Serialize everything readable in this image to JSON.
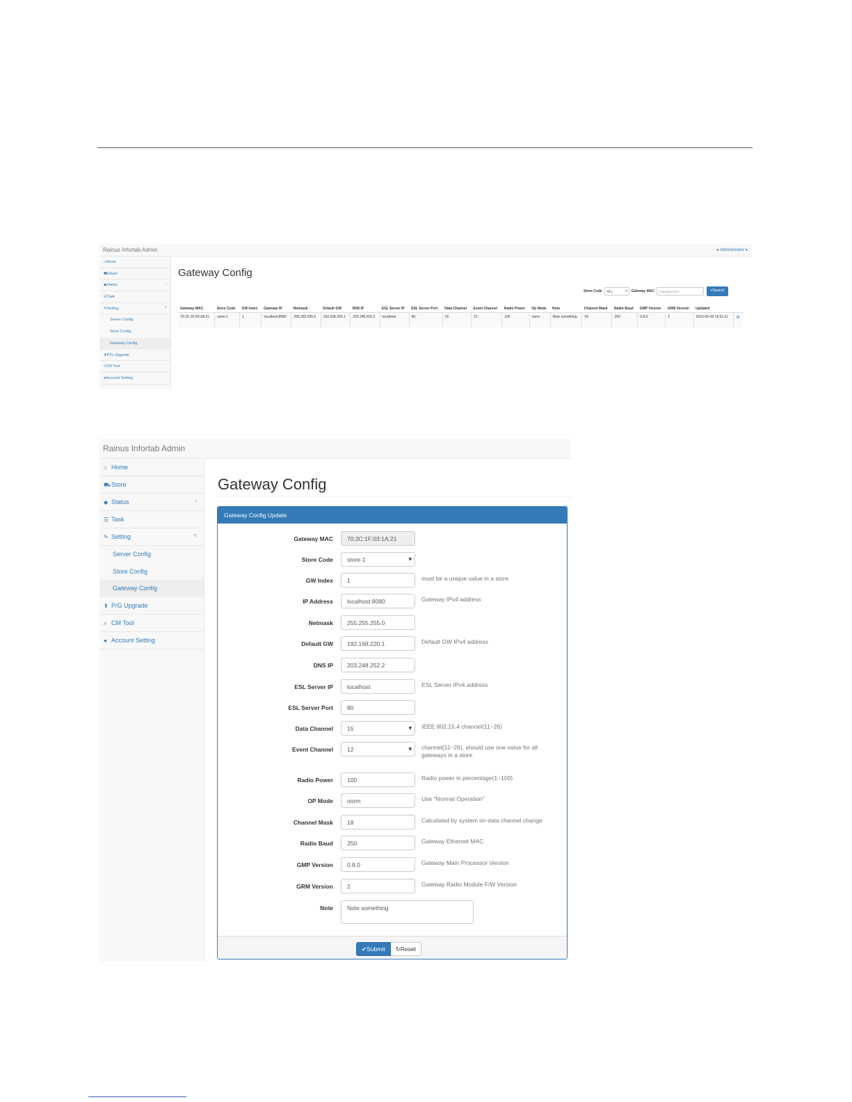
{
  "list_screenshot": {
    "brand": "Rainus Infortab Admin",
    "user": "Administrator",
    "sidebar": [
      {
        "icon": "home-icon",
        "glyph": "⌂",
        "label": "Home"
      },
      {
        "icon": "cart-icon",
        "glyph": "⛟",
        "label": "Store"
      },
      {
        "icon": "tags-icon",
        "glyph": "◆",
        "label": "Status",
        "arrow": "‹"
      },
      {
        "icon": "tasks-icon",
        "glyph": "☰",
        "label": "Task"
      },
      {
        "icon": "wrench-icon",
        "glyph": "✎",
        "label": "Setting",
        "arrow": "˅"
      },
      {
        "label": "Server Config",
        "sub": true
      },
      {
        "label": "Store Config",
        "sub": true
      },
      {
        "label": "Gateway Config",
        "sub": true,
        "active": true
      },
      {
        "icon": "upload-icon",
        "glyph": "⬆",
        "label": "P/G Upgrade"
      },
      {
        "icon": "search-icon",
        "glyph": "⌕",
        "label": "CM Tool"
      },
      {
        "icon": "user-icon",
        "glyph": "●",
        "label": "Account Setting"
      }
    ],
    "title": "Gateway Config",
    "filters": {
      "store_code_label": "Store Code",
      "store_code_value": "ALL",
      "gateway_mac_label": "Gateway MAC",
      "gateway_mac_placeholder": "Gateway MAC",
      "search_label": "Search"
    },
    "columns": [
      "Gateway MAC",
      "Store Code",
      "GW Index",
      "Gateway IP",
      "Netmask",
      "Default GW",
      "DNS IP",
      "ESL Server IP",
      "ESL Server Port",
      "Data Channel",
      "Event Channel",
      "Radio Power",
      "Op Mode",
      "Note",
      "Channel Mask",
      "Radio Baud",
      "GMP Version",
      "GRM Version",
      "Updated",
      ""
    ],
    "rows": [
      [
        "70:2C:1F:03:1A:21",
        "store-1",
        "1",
        "localhost:8080",
        "255.255.255.0",
        "192.168.220.1",
        "203.248.252.2",
        "localhost",
        "80",
        "15",
        "12",
        "100",
        "norm",
        "Note something",
        "18",
        "250",
        "0.8.0",
        "2",
        "2016-05-09 19:31:11",
        "⚙"
      ]
    ]
  },
  "form_screenshot": {
    "brand": "Rainus Infortab Admin",
    "sidebar": [
      {
        "icon": "home-icon",
        "glyph": "⌂",
        "label": "Home"
      },
      {
        "icon": "cart-icon",
        "glyph": "⛟",
        "label": "Store"
      },
      {
        "icon": "tags-icon",
        "glyph": "◆",
        "label": "Status",
        "arrow": "‹"
      },
      {
        "icon": "tasks-icon",
        "glyph": "☰",
        "label": "Task"
      },
      {
        "icon": "wrench-icon",
        "glyph": "✎",
        "label": "Setting",
        "arrow": "˅"
      },
      {
        "label": "Server Config",
        "sub": true
      },
      {
        "label": "Store Config",
        "sub": true
      },
      {
        "label": "Gateway Config",
        "sub": true,
        "active": true
      },
      {
        "icon": "upload-icon",
        "glyph": "⬆",
        "label": "P/G Upgrade"
      },
      {
        "icon": "search-icon",
        "glyph": "⌕",
        "label": "CM Tool"
      },
      {
        "icon": "user-icon",
        "glyph": "●",
        "label": "Account Setting"
      }
    ],
    "title": "Gateway Config",
    "panel_title": "Gateway Config Update",
    "fields": [
      {
        "label": "Gateway MAC",
        "value": "70:2C:1F:03:1A:21",
        "kind": "readonly",
        "help": ""
      },
      {
        "label": "Store Code",
        "value": "store-1",
        "kind": "select",
        "help": ""
      },
      {
        "label": "GW Index",
        "value": "1",
        "kind": "text",
        "help": "must be a unique value in a store"
      },
      {
        "label": "IP Address",
        "value": "localhost:8080",
        "kind": "text",
        "help": "Gateway IPv4 address"
      },
      {
        "label": "Netmask",
        "value": "255.255.255.0",
        "kind": "text",
        "help": ""
      },
      {
        "label": "Default GW",
        "value": "192.168.220.1",
        "kind": "text",
        "help": "Default GW IPv4 address"
      },
      {
        "label": "DNS IP",
        "value": "203.248.252.2",
        "kind": "text",
        "help": ""
      },
      {
        "label": "ESL Server IP",
        "value": "localhost",
        "kind": "text",
        "help": "ESL Server IPv4 address"
      },
      {
        "label": "ESL Server Port",
        "value": "80",
        "kind": "text",
        "help": ""
      },
      {
        "label": "Data Channel",
        "value": "15",
        "kind": "select",
        "help": "IEEE 802.15.4 channel(11~26)"
      },
      {
        "label": "Event Channel",
        "value": "12",
        "kind": "select",
        "help": "channel(11~26), should use one value for all gateways in a store"
      },
      {
        "label": "Radio Power",
        "value": "100",
        "kind": "text",
        "help": "Radio power in percentage(1~100)"
      },
      {
        "label": "OP Mode",
        "value": "norm",
        "kind": "text",
        "help": "Use \"Normal Operation\""
      },
      {
        "label": "Channel Mask",
        "value": "18",
        "kind": "text",
        "help": "Calculated by system on data channel change"
      },
      {
        "label": "Radio Baud",
        "value": "250",
        "kind": "text",
        "help": "Gateway Ethernet MAC"
      },
      {
        "label": "GMP Version",
        "value": "0.8.0",
        "kind": "text",
        "help": "Gateway Main Processor Version"
      },
      {
        "label": "GRM Version",
        "value": "2",
        "kind": "text",
        "help": "Gateway Radio Module F/W Version"
      },
      {
        "label": "Note",
        "value": "Note something",
        "kind": "textarea",
        "help": ""
      }
    ],
    "submit_label": "✔Submit",
    "reset_label": "↻Reset"
  }
}
